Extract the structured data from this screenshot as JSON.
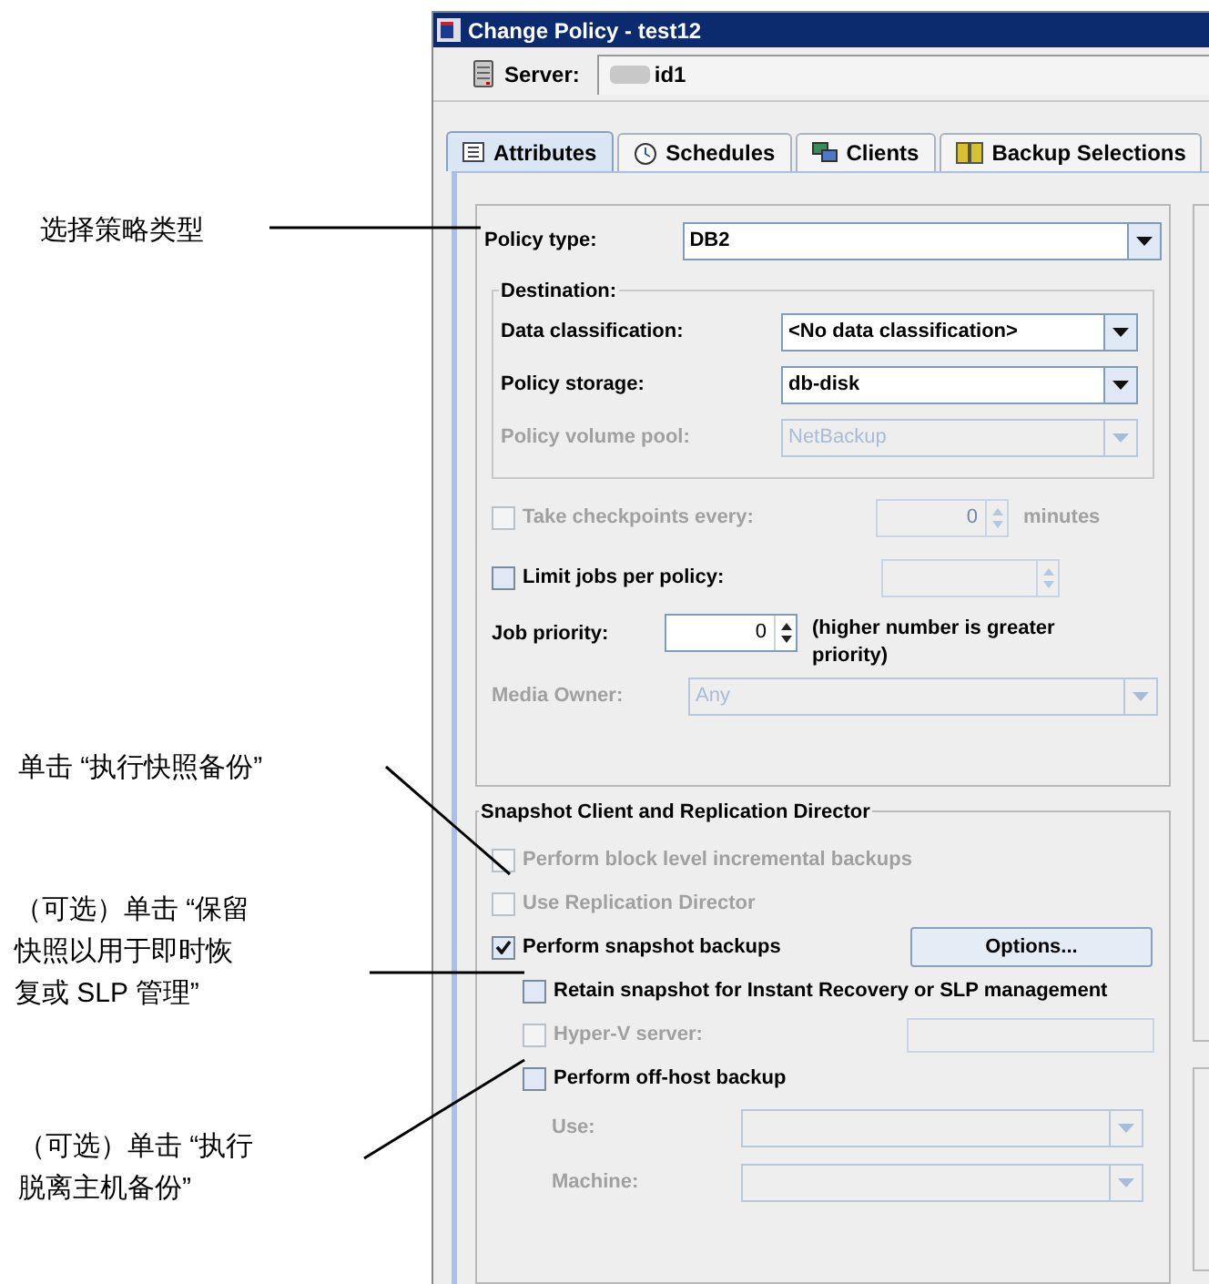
{
  "window": {
    "title": "Change Policy - test12"
  },
  "server": {
    "label": "Server:",
    "value": "id1"
  },
  "tabs": [
    {
      "label": "Attributes",
      "selected": true,
      "kind": "list"
    },
    {
      "label": "Schedules",
      "selected": false,
      "kind": "clock"
    },
    {
      "label": "Clients",
      "selected": false,
      "kind": "computer"
    },
    {
      "label": "Backup Selections",
      "selected": false,
      "kind": "book"
    }
  ],
  "attributes": {
    "policy_type": {
      "label": "Policy type:",
      "value": "DB2"
    },
    "destination": {
      "title": "Destination:",
      "fields": [
        {
          "label": "Data classification:",
          "value": "<No data classification>",
          "disabled": false
        },
        {
          "label": "Policy storage:",
          "value": "db-disk",
          "disabled": false
        },
        {
          "label": "Policy volume pool:",
          "value": "NetBackup",
          "disabled": true
        }
      ]
    },
    "checkpoints": {
      "label": "Take checkpoints every:",
      "checked": false,
      "disabled": true,
      "value": "0",
      "unit": "minutes"
    },
    "limit_jobs": {
      "label": "Limit jobs per policy:",
      "checked": false,
      "disabled": false
    },
    "job_priority": {
      "label": "Job priority:",
      "value": "0",
      "note": "(higher number is greater priority)"
    },
    "media_owner": {
      "label": "Media Owner:",
      "value": "Any",
      "disabled": true
    }
  },
  "snapshot": {
    "title": "Snapshot Client and Replication Director",
    "options": [
      {
        "label": "Perform block level incremental backups",
        "checked": false,
        "disabled": true,
        "indented": false
      },
      {
        "label": "Use Replication Director",
        "checked": false,
        "disabled": true,
        "indented": false
      },
      {
        "label": "Perform snapshot backups",
        "checked": true,
        "disabled": false,
        "indented": false
      },
      {
        "label": "Retain snapshot for Instant Recovery or SLP management",
        "checked": false,
        "disabled": false,
        "indented": true
      },
      {
        "label": "Hyper-V server:",
        "checked": false,
        "disabled": true,
        "indented": true
      },
      {
        "label": "Perform off-host backup",
        "checked": false,
        "disabled": false,
        "indented": true
      }
    ],
    "options_button": "Options...",
    "offhost_fields": [
      {
        "label": "Use:",
        "disabled": true
      },
      {
        "label": "Machine:",
        "disabled": true
      }
    ]
  },
  "callouts": [
    {
      "text": "选择策略类型"
    },
    {
      "text": "单击 “执行快照备份”"
    },
    {
      "text": "（可选）单击 “保留快照以用于即时恢复或 SLP 管理”"
    },
    {
      "text": "（可选）单击 “执行脱离主机备份”"
    }
  ]
}
